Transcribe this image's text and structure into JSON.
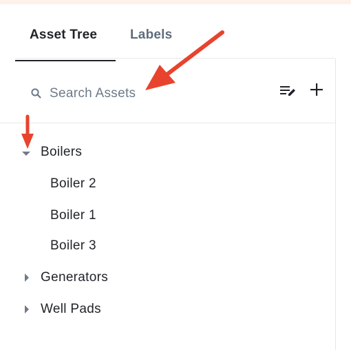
{
  "tabs": [
    {
      "label": "Asset Tree",
      "active": true
    },
    {
      "label": "Labels",
      "active": false
    }
  ],
  "search": {
    "placeholder": "Search Assets",
    "value": ""
  },
  "toolbar": {
    "icons": [
      "list-edit-icon",
      "add-icon"
    ]
  },
  "tree": [
    {
      "label": "Boilers",
      "expanded": true,
      "children": [
        {
          "label": "Boiler 2"
        },
        {
          "label": "Boiler 1"
        },
        {
          "label": "Boiler 3"
        }
      ]
    },
    {
      "label": "Generators",
      "expanded": false
    },
    {
      "label": "Well Pads",
      "expanded": false
    }
  ],
  "colors": {
    "text": "#1f2328",
    "muted": "#5f6c7b",
    "caret": "#6f7b89",
    "annotation_arrow": "#e8432e",
    "header_strip": "#fdf1ea"
  }
}
